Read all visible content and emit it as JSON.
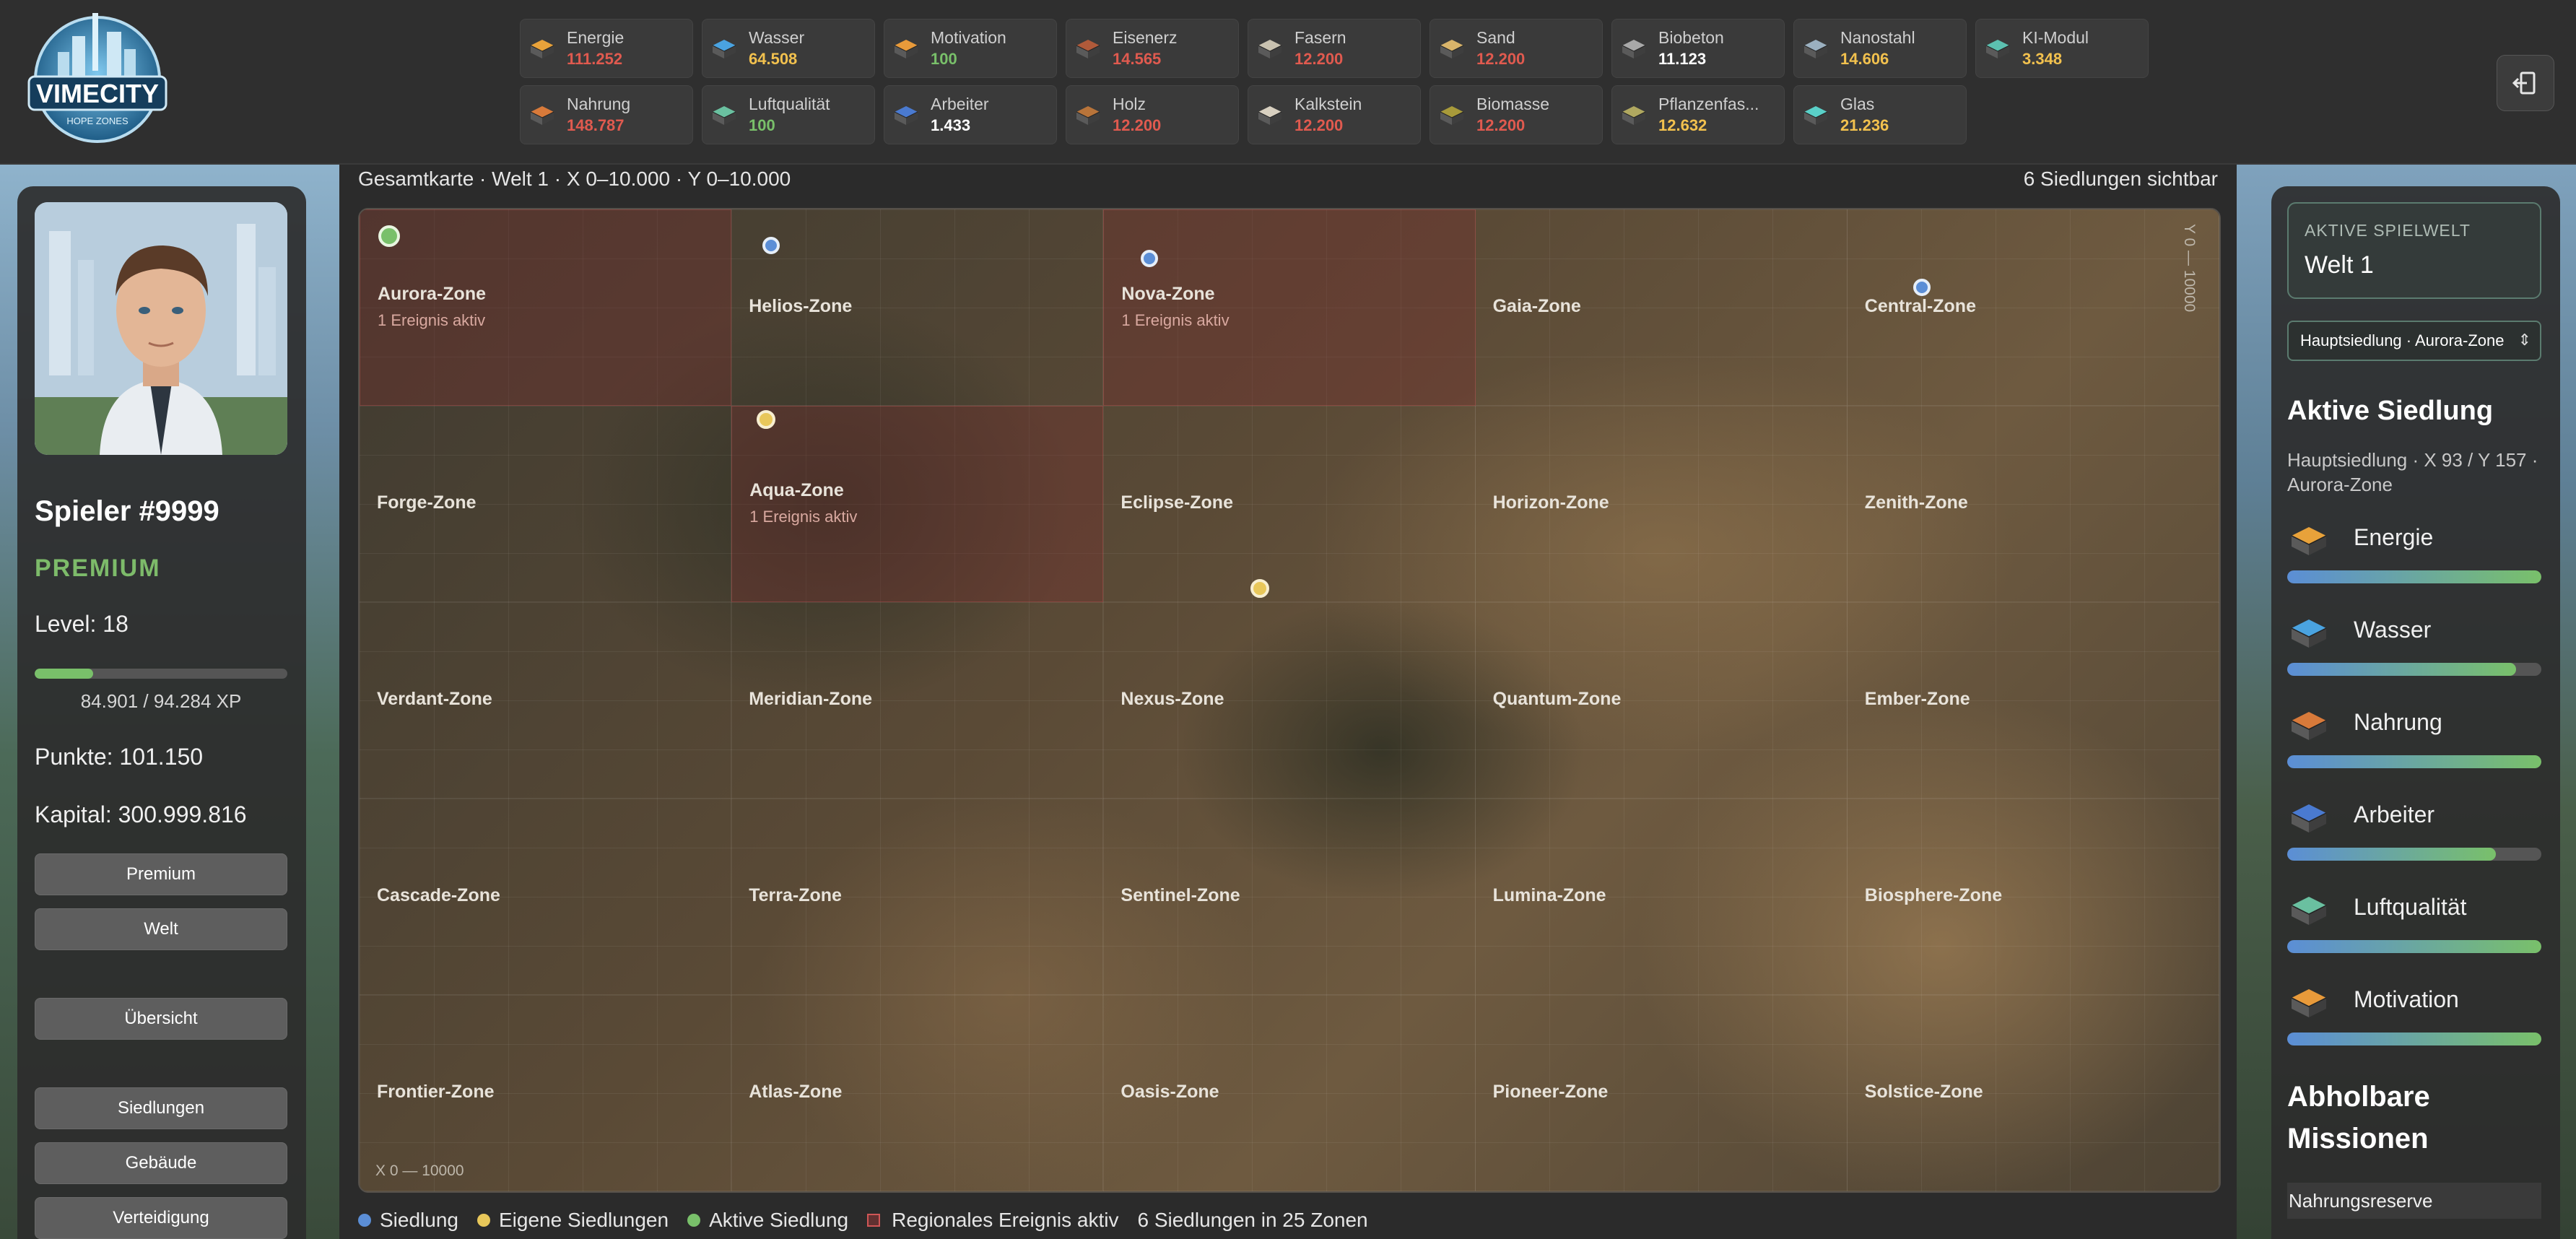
{
  "brand": {
    "logo_text": "VIMECITY",
    "logo_sub": "HOPE ZONES"
  },
  "colors": {
    "accent_green": "#79c06a",
    "value_red": "#e05a4f",
    "value_yellow": "#f2c14e",
    "value_green": "#79c06a",
    "value_white": "#ffffff",
    "marker_blue": "#5b8ed6",
    "marker_yellow": "#e8c75a",
    "event_red": "#d05656"
  },
  "resources": [
    {
      "name": "Energie",
      "value": "111.252",
      "color": "red",
      "icon": "energy-crate-icon"
    },
    {
      "name": "Wasser",
      "value": "64.508",
      "color": "yellow",
      "icon": "water-crate-icon"
    },
    {
      "name": "Motivation",
      "value": "100",
      "color": "green",
      "icon": "motivation-crate-icon"
    },
    {
      "name": "Eisenerz",
      "value": "14.565",
      "color": "red",
      "icon": "iron-ore-crate-icon"
    },
    {
      "name": "Fasern",
      "value": "12.200",
      "color": "red",
      "icon": "fiber-crate-icon"
    },
    {
      "name": "Sand",
      "value": "12.200",
      "color": "red",
      "icon": "sand-crate-icon"
    },
    {
      "name": "Biobeton",
      "value": "11.123",
      "color": "white",
      "icon": "biobeton-crate-icon"
    },
    {
      "name": "Nanostahl",
      "value": "14.606",
      "color": "yellow",
      "icon": "nanosteel-crate-icon"
    },
    {
      "name": "KI-Modul",
      "value": "3.348",
      "color": "yellow",
      "icon": "ai-module-crate-icon"
    },
    {
      "name": "Nahrung",
      "value": "148.787",
      "color": "red",
      "icon": "food-crate-icon"
    },
    {
      "name": "Luftqualität",
      "value": "100",
      "color": "green",
      "icon": "air-quality-crate-icon"
    },
    {
      "name": "Arbeiter",
      "value": "1.433",
      "color": "white",
      "icon": "workers-crate-icon"
    },
    {
      "name": "Holz",
      "value": "12.200",
      "color": "red",
      "icon": "wood-crate-icon"
    },
    {
      "name": "Kalkstein",
      "value": "12.200",
      "color": "red",
      "icon": "limestone-crate-icon"
    },
    {
      "name": "Biomasse",
      "value": "12.200",
      "color": "red",
      "icon": "biomass-crate-icon"
    },
    {
      "name": "Pflanzenfas...",
      "value": "12.632",
      "color": "yellow",
      "icon": "plant-fiber-crate-icon"
    },
    {
      "name": "Glas",
      "value": "21.236",
      "color": "yellow",
      "icon": "glass-crate-icon"
    }
  ],
  "player": {
    "name": "Spieler #9999",
    "tier": "PREMIUM",
    "level": "Level: 18",
    "xp_text": "84.901 / 94.284 XP",
    "xp_progress": 0.23,
    "points": "Punkte: 101.150",
    "capital": "Kapital: 300.999.816"
  },
  "nav_buttons": [
    "Premium",
    "Welt",
    "Übersicht",
    "Siedlungen",
    "Gebäude",
    "Verteidigung"
  ],
  "map": {
    "header_left": "Gesamtkarte · Welt 1 · X 0–10.000 · Y 0–10.000",
    "header_right": "6 Siedlungen sichtbar",
    "x_axis": "X 0 — 10000",
    "y_axis": "Y 0 — 10000",
    "zones": [
      {
        "name": "Aurora-Zone",
        "event": "1 Ereignis aktiv"
      },
      {
        "name": "Helios-Zone",
        "event": ""
      },
      {
        "name": "Nova-Zone",
        "event": "1 Ereignis aktiv"
      },
      {
        "name": "Gaia-Zone",
        "event": ""
      },
      {
        "name": "Central-Zone",
        "event": ""
      },
      {
        "name": "Forge-Zone",
        "event": ""
      },
      {
        "name": "Aqua-Zone",
        "event": "1 Ereignis aktiv"
      },
      {
        "name": "Eclipse-Zone",
        "event": ""
      },
      {
        "name": "Horizon-Zone",
        "event": ""
      },
      {
        "name": "Zenith-Zone",
        "event": ""
      },
      {
        "name": "Verdant-Zone",
        "event": ""
      },
      {
        "name": "Meridian-Zone",
        "event": ""
      },
      {
        "name": "Nexus-Zone",
        "event": ""
      },
      {
        "name": "Quantum-Zone",
        "event": ""
      },
      {
        "name": "Ember-Zone",
        "event": ""
      },
      {
        "name": "Cascade-Zone",
        "event": ""
      },
      {
        "name": "Terra-Zone",
        "event": ""
      },
      {
        "name": "Sentinel-Zone",
        "event": ""
      },
      {
        "name": "Lumina-Zone",
        "event": ""
      },
      {
        "name": "Biosphere-Zone",
        "event": ""
      },
      {
        "name": "Frontier-Zone",
        "event": ""
      },
      {
        "name": "Atlas-Zone",
        "event": ""
      },
      {
        "name": "Oasis-Zone",
        "event": ""
      },
      {
        "name": "Pioneer-Zone",
        "event": ""
      },
      {
        "name": "Solstice-Zone",
        "event": ""
      }
    ]
  },
  "legend": {
    "settlement": "Siedlung",
    "own": "Eigene Siedlungen",
    "active": "Aktive Siedlung",
    "event": "Regionales Ereignis aktiv",
    "summary": "6 Siedlungen in 25 Zonen"
  },
  "right_panel": {
    "world_label": "AKTIVE SPIELWELT",
    "world_value": "Welt 1",
    "settlement_select": "Hauptsiedlung · Aurora-Zone",
    "active_title": "Aktive Siedlung",
    "active_sub": "Hauptsiedlung · X 93 / Y 157 · Aurora-Zone",
    "stats": [
      {
        "label": "Energie",
        "level": 1.0,
        "icon": "energy-crate-icon"
      },
      {
        "label": "Wasser",
        "level": 0.9,
        "icon": "water-crate-icon"
      },
      {
        "label": "Nahrung",
        "level": 1.0,
        "icon": "food-crate-icon"
      },
      {
        "label": "Arbeiter",
        "level": 0.82,
        "icon": "workers-crate-icon"
      },
      {
        "label": "Luftqualität",
        "level": 1.0,
        "icon": "air-quality-crate-icon"
      },
      {
        "label": "Motivation",
        "level": 1.0,
        "icon": "motivation-crate-icon"
      }
    ],
    "missions_title": "Abholbare Missionen",
    "mission_item": "Nahrungsreserve"
  }
}
